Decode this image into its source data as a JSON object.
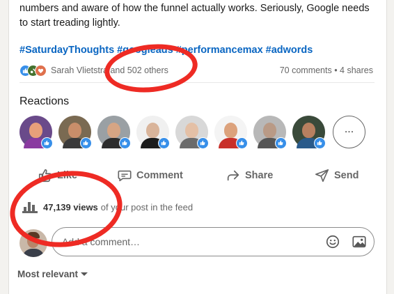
{
  "post": {
    "text_line1": "numbers and aware of how the funnel actually works. Seriously, Google needs",
    "text_line2": "to start treading lightly.",
    "hashtags": [
      "#SaturdayThoughts",
      "#googleads",
      "#performancemax",
      "#adwords"
    ]
  },
  "social": {
    "likers": "Sarah Vlietstra and 502 others",
    "counts": "70 comments • 4 shares"
  },
  "reactions": {
    "title": "Reactions",
    "more_label": "...",
    "avatars": [
      {
        "label": "reactor-1",
        "bg": "#6a4a8a",
        "skin": "#e8a07a",
        "shirt": "#8a3aa0"
      },
      {
        "label": "reactor-2",
        "bg": "#7a6a52",
        "skin": "#c98e6a",
        "shirt": "#3a3a3a"
      },
      {
        "label": "reactor-3",
        "bg": "#9aa0a4",
        "skin": "#d6a584",
        "shirt": "#2c2c2c"
      },
      {
        "label": "reactor-4",
        "bg": "#f0f0f0",
        "skin": "#d9b49a",
        "shirt": "#1c1c1c"
      },
      {
        "label": "reactor-5",
        "bg": "#d8d8d8",
        "skin": "#e4c0a6",
        "shirt": "#6b6b6b"
      },
      {
        "label": "reactor-6",
        "bg": "#f4f4f4",
        "skin": "#dca27c",
        "shirt": "#c8302a"
      },
      {
        "label": "reactor-7",
        "bg": "#b8b8b8",
        "skin": "#b99a86",
        "shirt": "#555555"
      },
      {
        "label": "reactor-8",
        "bg": "#3a4a3a",
        "skin": "#b88060",
        "shirt": "#2a5a8a"
      }
    ]
  },
  "actions": {
    "like": "Like",
    "comment": "Comment",
    "share": "Share",
    "send": "Send"
  },
  "views": {
    "count": "47,139 views",
    "suffix": "of your post in the feed"
  },
  "comment": {
    "placeholder": "Add a comment…"
  },
  "sort": {
    "label": "Most relevant"
  },
  "colors": {
    "link": "#0a66c2",
    "annotation": "#ee2b24"
  }
}
